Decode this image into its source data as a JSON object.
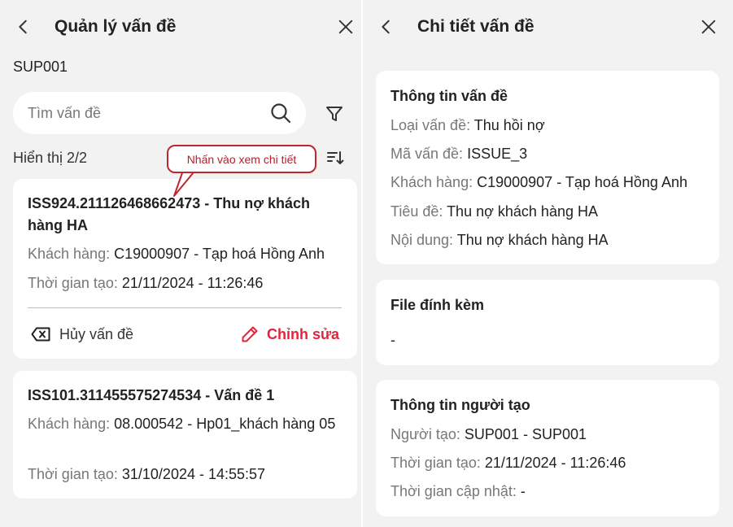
{
  "left_panel": {
    "title": "Quản lý vấn đề",
    "store_code": "SUP001",
    "search": {
      "placeholder": "Tìm vấn đề"
    },
    "count_text": "Hiển thị 2/2",
    "callout": "Nhấn vào xem chi tiết",
    "issues": [
      {
        "title": "ISS924.211126468662473 - Thu nợ khách hàng HA",
        "customer_label": "Khách hàng:",
        "customer_value": "C19000907 - Tạp hoá Hồng Anh",
        "created_label": "Thời gian tạo:",
        "created_value": "21/11/2024 - 11:26:46",
        "cancel_label": "Hủy vấn đề",
        "edit_label": "Chỉnh sửa"
      },
      {
        "title": "ISS101.311455575274534 - Vấn đề 1",
        "customer_label": "Khách hàng:",
        "customer_value": "08.000542 - Hp01_khách hàng 05",
        "created_label": "Thời gian tạo:",
        "created_value": "31/10/2024 - 14:55:57"
      }
    ]
  },
  "right_panel": {
    "title": "Chi tiết vấn đề",
    "info_section": {
      "title": "Thông tin vấn đề",
      "rows": [
        {
          "label": "Loại vấn đề:",
          "value": "Thu hồi nợ"
        },
        {
          "label": "Mã vấn đề:",
          "value": "ISSUE_3"
        },
        {
          "label": "Khách hàng:",
          "value": "C19000907 - Tạp hoá Hồng Anh"
        },
        {
          "label": "Tiêu đề:",
          "value": "Thu nợ khách hàng HA"
        },
        {
          "label": "Nội dung:",
          "value": "Thu nợ khách hàng HA"
        }
      ]
    },
    "attachment_section": {
      "title": "File đính kèm",
      "value": "-"
    },
    "creator_section": {
      "title": "Thông tin người tạo",
      "rows": [
        {
          "label": "Người tạo:",
          "value": "SUP001 - SUP001"
        },
        {
          "label": "Thời gian tạo:",
          "value": "21/11/2024 - 11:26:46"
        },
        {
          "label": "Thời gian cập nhật:",
          "value": "-"
        }
      ]
    }
  },
  "colors": {
    "accent": "#e3243b",
    "callout_border": "#c0262d",
    "background": "#f2f2f2",
    "muted_text": "#777777"
  },
  "icons": [
    "back-icon",
    "close-icon",
    "search-icon",
    "filter-icon",
    "sort-icon",
    "cancel-issue-icon",
    "edit-pencil-icon"
  ]
}
